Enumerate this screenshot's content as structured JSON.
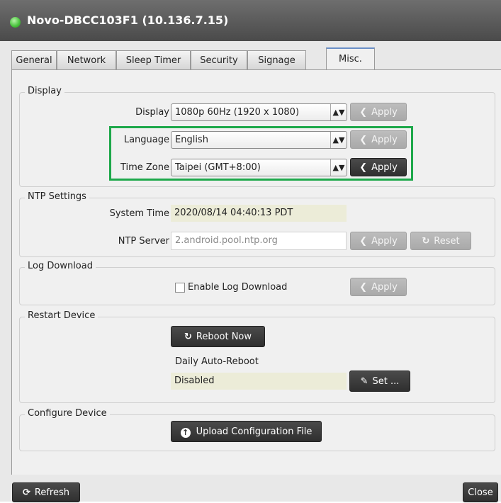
{
  "window": {
    "title": "Novo-DBCC103F1 (10.136.7.15)"
  },
  "tabs": [
    {
      "label": "General"
    },
    {
      "label": "Network"
    },
    {
      "label": "Sleep Timer"
    },
    {
      "label": "Security"
    },
    {
      "label": "Signage"
    },
    {
      "label": "Misc.",
      "active": true
    }
  ],
  "display_group": {
    "title": "Display",
    "display_label": "Display",
    "display_value": "1080p 60Hz (1920 x 1080)",
    "language_label": "Language",
    "language_value": "English",
    "timezone_label": "Time Zone",
    "timezone_value": "Taipei (GMT+8:00)",
    "apply_label": "Apply"
  },
  "ntp_group": {
    "title": "NTP Settings",
    "system_time_label": "System Time",
    "system_time_value": "2020/08/14 04:40:13 PDT",
    "ntp_server_label": "NTP Server",
    "ntp_server_placeholder": "2.android.pool.ntp.org",
    "apply_label": "Apply",
    "reset_label": "Reset"
  },
  "log_group": {
    "title": "Log Download",
    "enable_label": "Enable Log Download",
    "enabled": false,
    "apply_label": "Apply"
  },
  "restart_group": {
    "title": "Restart Device",
    "reboot_label": "Reboot Now",
    "auto_reboot_label": "Daily Auto-Reboot",
    "auto_reboot_value": "Disabled",
    "set_label": "Set ..."
  },
  "configure_group": {
    "title": "Configure Device",
    "upload_label": "Upload Configuration File"
  },
  "footer": {
    "refresh_label": "Refresh",
    "close_label": "Close"
  },
  "colors": {
    "highlight": "#1da84a",
    "title_bar": "#5a5a5a",
    "button_dark": "#3a3a3a"
  }
}
